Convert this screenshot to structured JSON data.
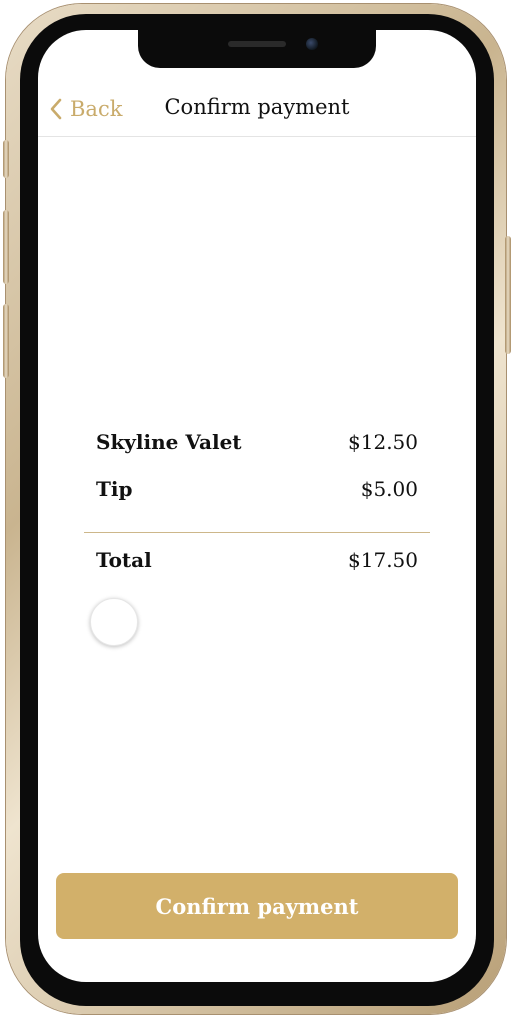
{
  "nav": {
    "back_label": "Back",
    "title": "Confirm payment"
  },
  "summary": {
    "items": [
      {
        "label": "Skyline Valet",
        "amount": "$12.50"
      },
      {
        "label": "Tip",
        "amount": "$5.00"
      }
    ],
    "total": {
      "label": "Total",
      "amount": "$17.50"
    }
  },
  "actions": {
    "confirm_label": "Confirm payment"
  },
  "colors": {
    "accent": "#d2b06a",
    "back_tint": "#c9ab6b",
    "frame_gold": "#c9b48f",
    "divider": "#cdb78a",
    "text": "#111111"
  },
  "icons": {
    "back": "chevron-left-icon"
  }
}
